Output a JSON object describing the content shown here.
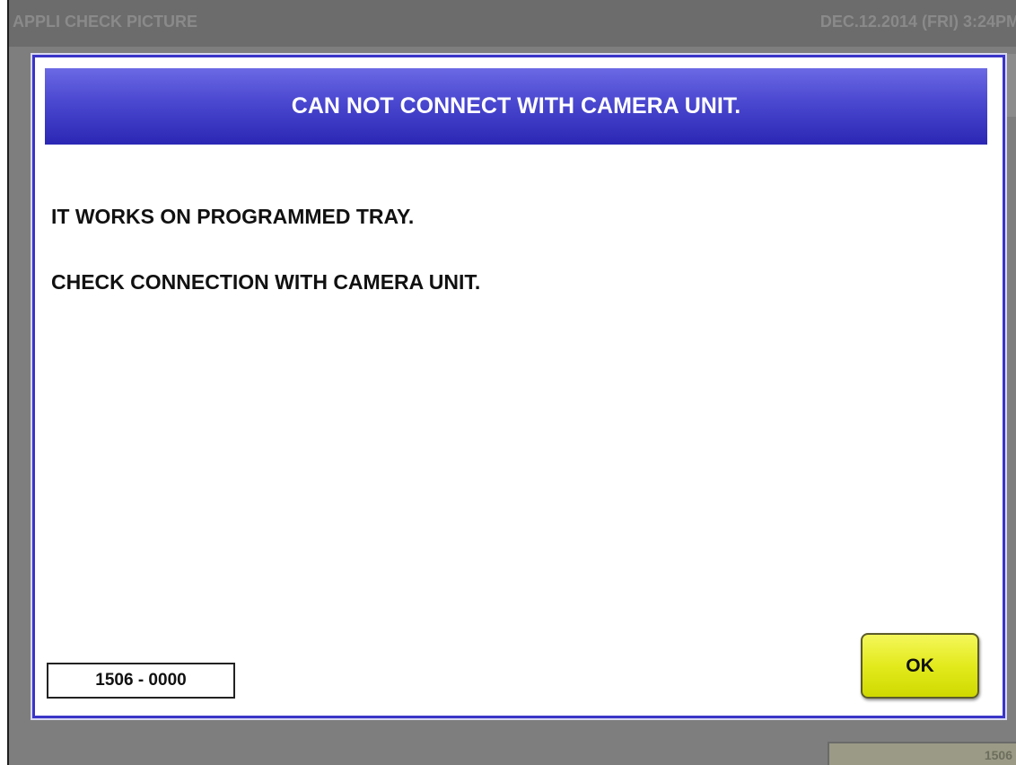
{
  "background": {
    "app_title": "APPLI CHECK PICTURE",
    "datetime": "DEC.12.2014 (FRI)   3:24PM",
    "footer_value": "1506"
  },
  "dialog": {
    "title": "CAN NOT CONNECT WITH CAMERA UNIT.",
    "message_line1": "IT WORKS ON PROGRAMMED TRAY.",
    "message_line2": "CHECK CONNECTION WITH CAMERA UNIT.",
    "error_code": "1506 - 0000",
    "ok_label": "OK"
  },
  "colors": {
    "header_blue": "#2b27b4",
    "border_blue": "#3a35c8",
    "ok_yellow": "#e3ea1d",
    "overlay_gray": "#7e7e7e"
  }
}
